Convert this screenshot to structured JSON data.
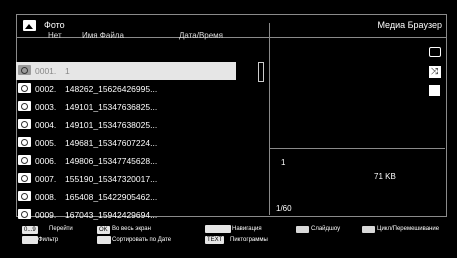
{
  "header": {
    "title": "Фото",
    "right_title": "Медиа Браузер"
  },
  "columns": {
    "num": "Нет",
    "name": "Имя Файла",
    "date": "Дата/Время"
  },
  "files": [
    {
      "num": "0001.",
      "name": "1",
      "selected": true
    },
    {
      "num": "0002.",
      "name": "148262_15626426995..."
    },
    {
      "num": "0003.",
      "name": "149101_15347636825..."
    },
    {
      "num": "0004.",
      "name": "149101_15347638025..."
    },
    {
      "num": "0005.",
      "name": "149681_15347607224..."
    },
    {
      "num": "0006.",
      "name": "149806_15347745628..."
    },
    {
      "num": "0007.",
      "name": "155190_15347320017..."
    },
    {
      "num": "0008.",
      "name": "165408_15422905462..."
    },
    {
      "num": "0009.",
      "name": "167043_15942429694..."
    }
  ],
  "info": {
    "line1": "1",
    "size": "71 KB",
    "page": "1/60"
  },
  "footer": {
    "k_goto": "0...9",
    "goto": "Перейти",
    "filter": "Фильтр",
    "k_ok": "OK",
    "fullscreen": "Во весь экран",
    "sort": "Сортировать по Дате",
    "navigation": "Навигация",
    "k_text": "TEXT",
    "pictograms": "Пиктограммы",
    "slideshow": "Слайдшоу",
    "loop": "Цикл/Перемешивание"
  }
}
